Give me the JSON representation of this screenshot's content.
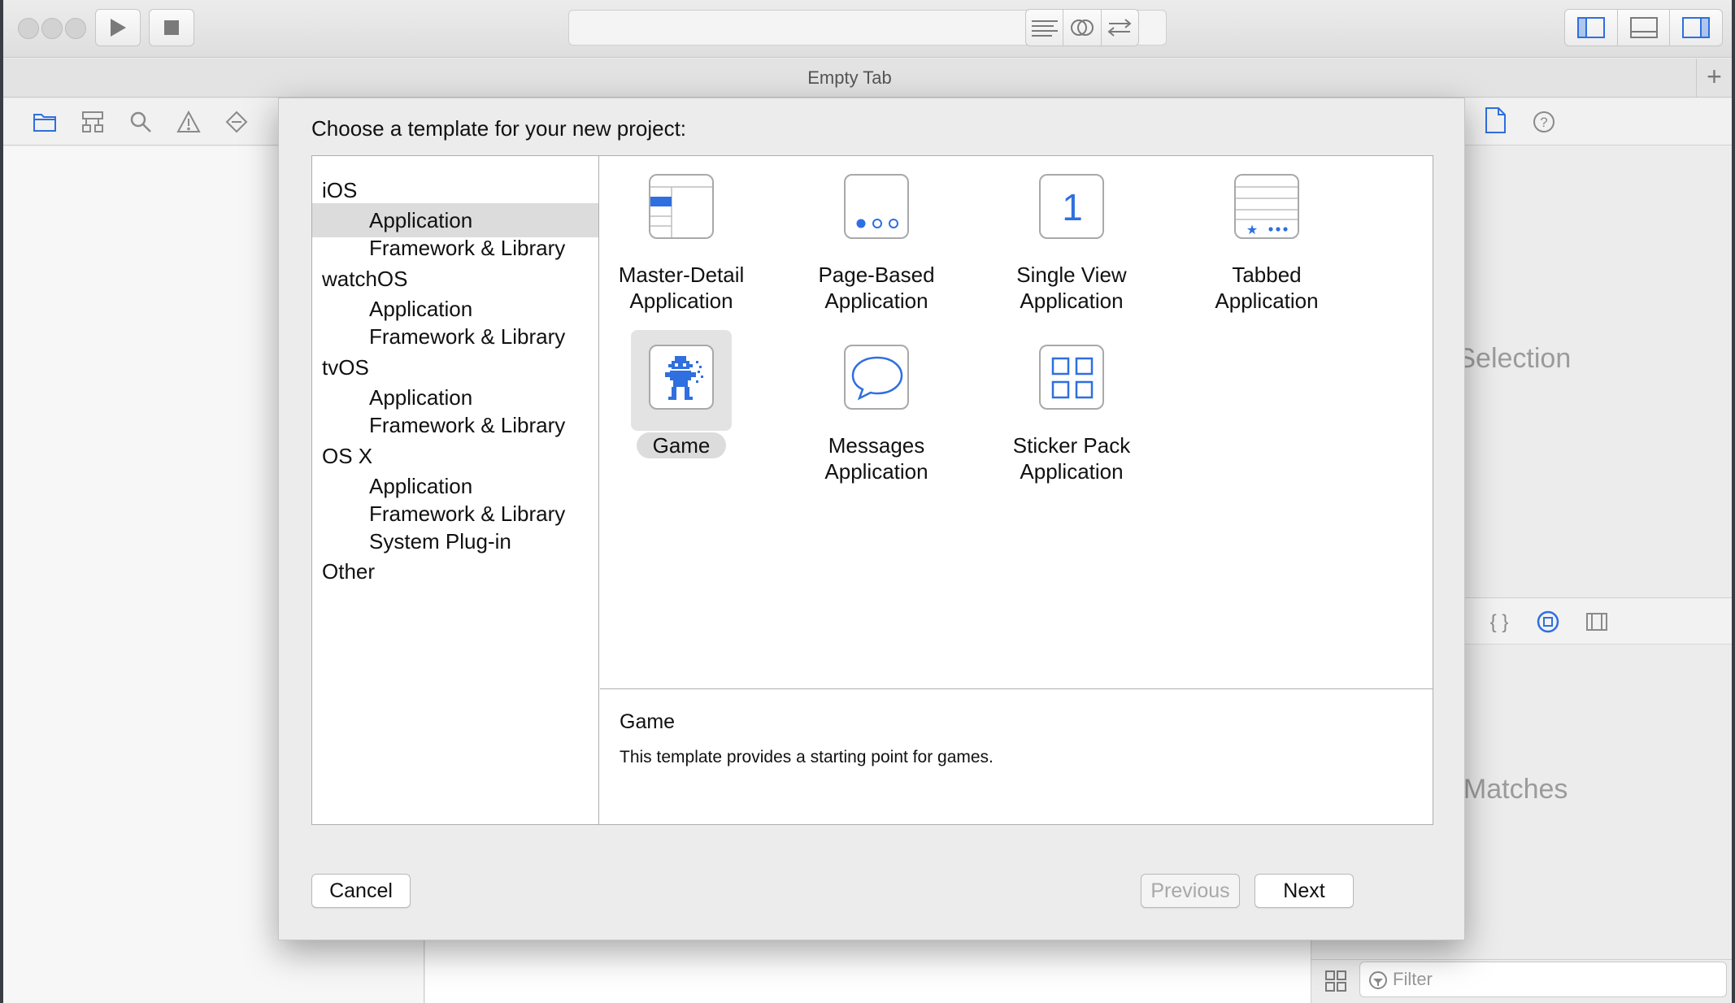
{
  "window": {
    "tab_title": "Empty Tab",
    "new_tab_glyph": "+"
  },
  "toolbar": {
    "icons": [
      "play-icon",
      "stop-icon",
      "standard-editor-icon",
      "assistant-editor-icon",
      "version-editor-icon",
      "toggle-navigator-icon",
      "toggle-debug-area-icon",
      "toggle-utilities-icon"
    ]
  },
  "navigator_icons": [
    "folder-icon",
    "hierarchy-icon",
    "search-icon",
    "warning-icon",
    "breakpoint-icon"
  ],
  "inspector": {
    "no_selection": "o Selection",
    "no_matches": "lo Matches",
    "filter_placeholder": "Filter"
  },
  "sheet": {
    "title": "Choose a template for your new project:",
    "platforms": [
      {
        "name": "iOS",
        "items": [
          "Application",
          "Framework & Library"
        ]
      },
      {
        "name": "watchOS",
        "items": [
          "Application",
          "Framework & Library"
        ]
      },
      {
        "name": "tvOS",
        "items": [
          "Application",
          "Framework & Library"
        ]
      },
      {
        "name": "OS X",
        "items": [
          "Application",
          "Framework & Library",
          "System Plug-in"
        ]
      },
      {
        "name": "Other",
        "items": []
      }
    ],
    "selected_platform_item": "iOS / Application",
    "templates": [
      {
        "line1": "Master-Detail",
        "line2": "Application",
        "icon": "master-detail-icon"
      },
      {
        "line1": "Page-Based",
        "line2": "Application",
        "icon": "page-based-icon"
      },
      {
        "line1": "Single View",
        "line2": "Application",
        "icon": "single-view-icon",
        "glyph": "1"
      },
      {
        "line1": "Tabbed",
        "line2": "Application",
        "icon": "tabbed-icon"
      },
      {
        "line1": "Game",
        "line2": "",
        "icon": "game-icon",
        "selected": true
      },
      {
        "line1": "Messages",
        "line2": "Application",
        "icon": "messages-icon"
      },
      {
        "line1": "Sticker Pack",
        "line2": "Application",
        "icon": "sticker-pack-icon"
      }
    ],
    "description": {
      "title": "Game",
      "text": "This template provides a starting point for games."
    },
    "buttons": {
      "cancel": "Cancel",
      "previous": "Previous",
      "next": "Next"
    }
  },
  "colors": {
    "accent": "#2f6fdf",
    "selection": "#dcdcdc"
  }
}
